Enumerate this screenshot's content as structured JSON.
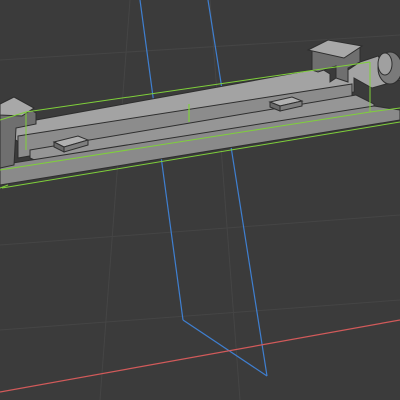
{
  "viewport": {
    "background": "#3b3b3b",
    "grid_color": "#464646",
    "selection_color": "#7fd03a",
    "plane_color": "#3f7fd0",
    "axis_x_color": "#d25a5a",
    "model_face_top": "#9e9e9e",
    "model_face_front": "#8a8a8a",
    "model_face_side": "#6f6f6f",
    "model_edge": "#2a2a2a"
  },
  "scene": {
    "object": "extruded-rail-part",
    "selected": true,
    "construction_plane_visible": true,
    "origin_axis_visible": true
  }
}
